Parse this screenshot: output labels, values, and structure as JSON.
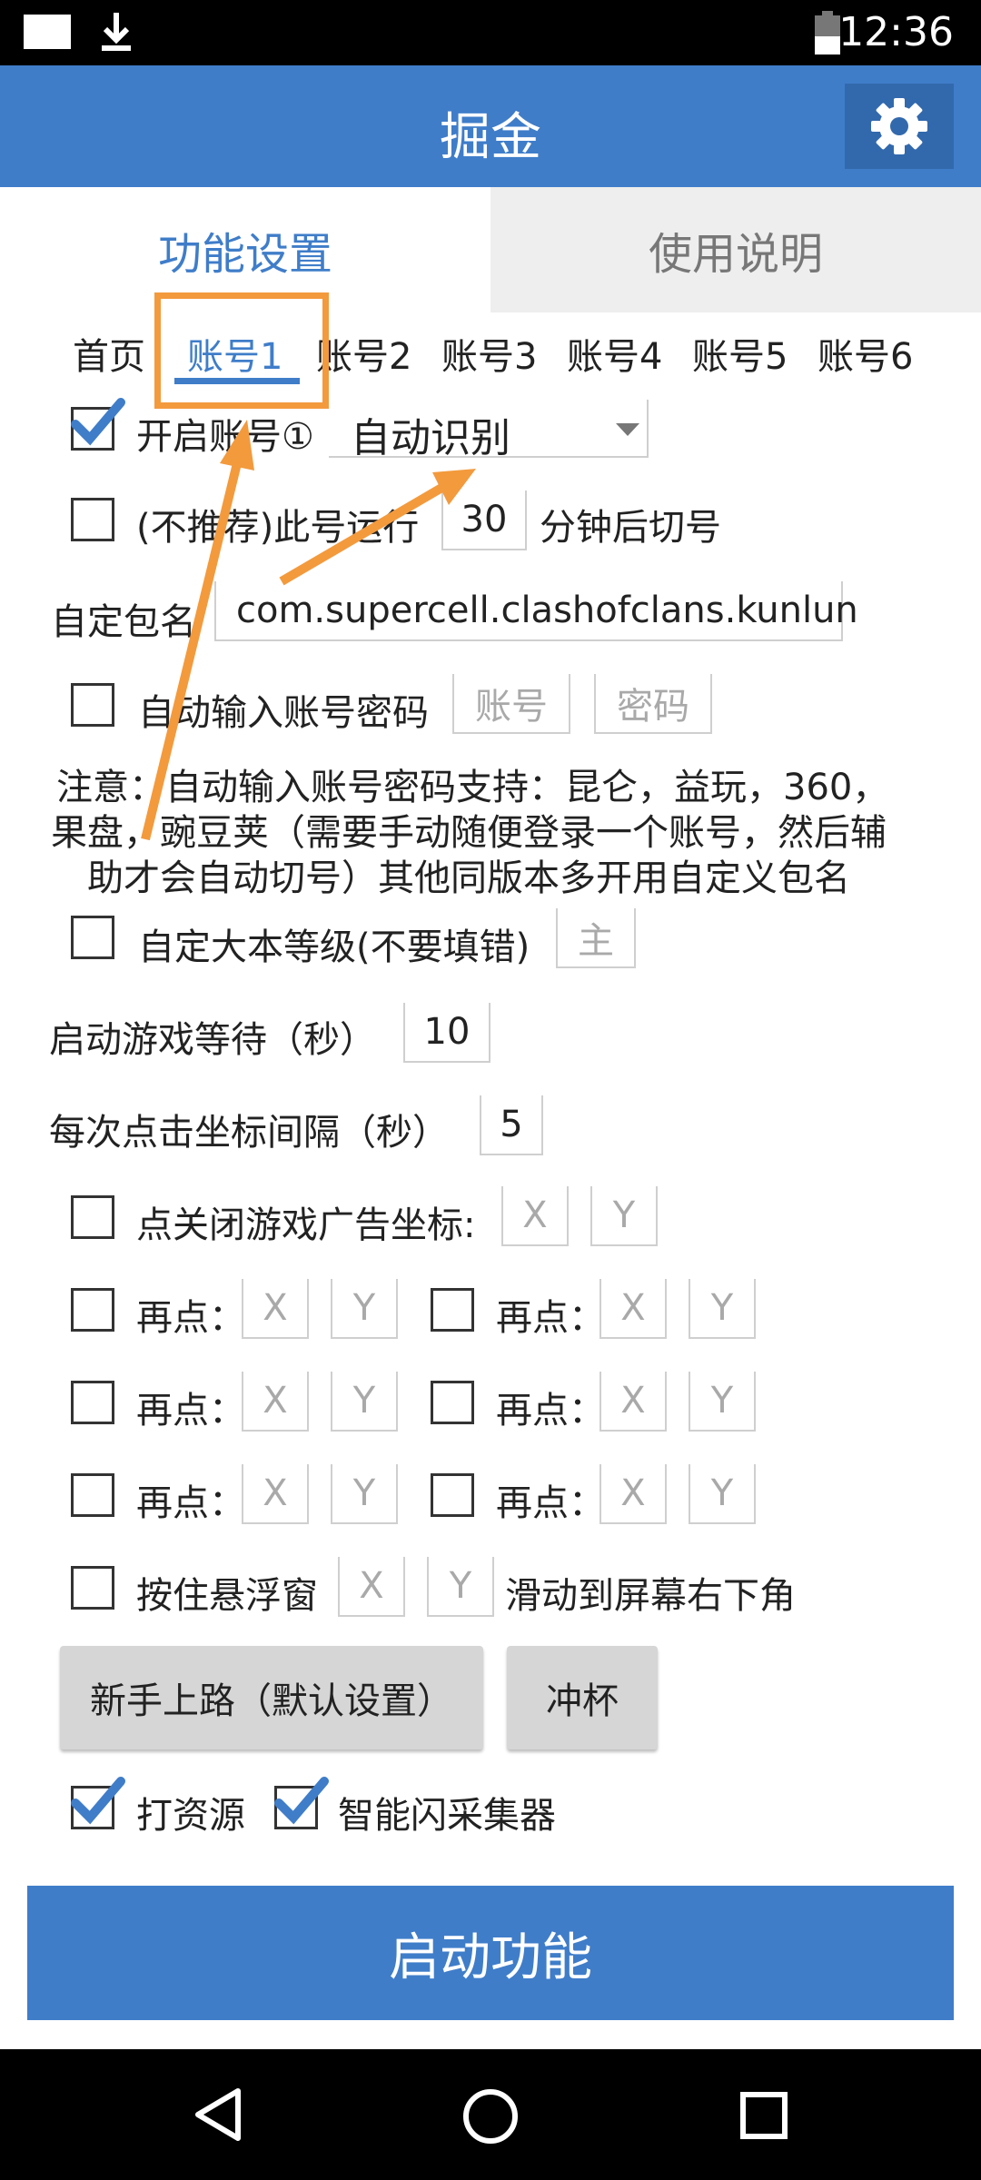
{
  "status_bar": {
    "time": "12:36"
  },
  "app_bar": {
    "title": "掘金"
  },
  "main_tabs": {
    "function_settings": "功能设置",
    "instructions": "使用说明"
  },
  "account_tabs": [
    "首页",
    "账号1",
    "账号2",
    "账号3",
    "账号4",
    "账号5",
    "账号6"
  ],
  "enable_account": {
    "label": "开启账号①",
    "checked": true,
    "dropdown_value": "自动识别"
  },
  "switch_after": {
    "label_prefix": "(不推荐)此号运行",
    "value": "30",
    "label_suffix": "分钟后切号"
  },
  "custom_package": {
    "label": "自定包名",
    "value": "com.supercell.clashofclans.kunlun"
  },
  "auto_login": {
    "label": "自动输入账号密码",
    "account_placeholder": "账号",
    "password_placeholder": "密码"
  },
  "note": {
    "line1": "注意：自动输入账号密码支持：昆仑，益玩，360，",
    "line2": "果盘，豌豆荚（需要手动随便登录一个账号，然后辅",
    "line3": "助才会自动切号）其他同版本多开用自定义包名"
  },
  "base_level": {
    "label": "自定大本等级(不要填错)",
    "placeholder": "主"
  },
  "launch_wait": {
    "label": "启动游戏等待（秒）",
    "value": "10"
  },
  "click_interval": {
    "label": "每次点击坐标间隔（秒）",
    "value": "5"
  },
  "close_ad": {
    "label": "点关闭游戏广告坐标:",
    "x_placeholder": "X",
    "y_placeholder": "Y"
  },
  "click_again": {
    "label": "再点：",
    "x_placeholder": "X",
    "y_placeholder": "Y"
  },
  "float_window": {
    "label": "按住悬浮窗",
    "x_placeholder": "X",
    "y_placeholder": "Y",
    "suffix": "滑动到屏幕右下角"
  },
  "buttons": {
    "newbie": "新手上路（默认设置）",
    "rush": "冲杯"
  },
  "options": {
    "farm": "打资源",
    "smart_collect": "智能闪采集器"
  },
  "start_button": "启动功能",
  "colors": {
    "primary": "#3f7dc9",
    "annotation": "#f39a3d"
  }
}
